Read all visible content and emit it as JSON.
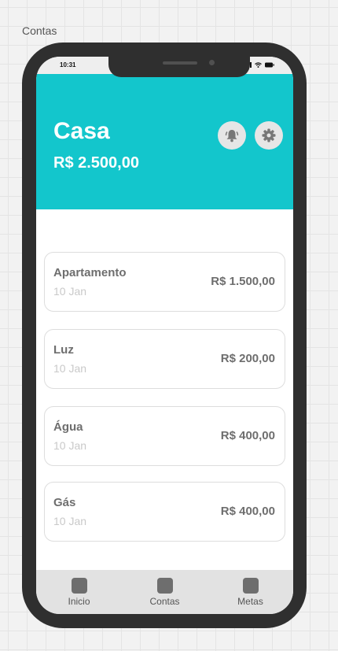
{
  "frame": {
    "label": "Contas"
  },
  "status_bar": {
    "time": "10:31",
    "icons": [
      "signal-icon",
      "wifi-icon",
      "battery-icon"
    ]
  },
  "header": {
    "title": "Casa",
    "balance": "R$ 2.500,00",
    "background_color": "#13c6cc",
    "actions": [
      {
        "icon": "bell-icon"
      },
      {
        "icon": "gear-icon"
      }
    ]
  },
  "bills": [
    {
      "name": "Apartamento",
      "date": "10 Jan",
      "amount": "R$ 1.500,00"
    },
    {
      "name": "Luz",
      "date": "10 Jan",
      "amount": "R$ 200,00"
    },
    {
      "name": "Água",
      "date": "10 Jan",
      "amount": "R$ 400,00"
    },
    {
      "name": "Gás",
      "date": "10 Jan",
      "amount": "R$ 400,00"
    }
  ],
  "bottom_nav": {
    "items": [
      {
        "label": "Inicio",
        "icon": "home-icon"
      },
      {
        "label": "Contas",
        "icon": "bills-icon"
      },
      {
        "label": "Metas",
        "icon": "goals-icon"
      }
    ]
  }
}
